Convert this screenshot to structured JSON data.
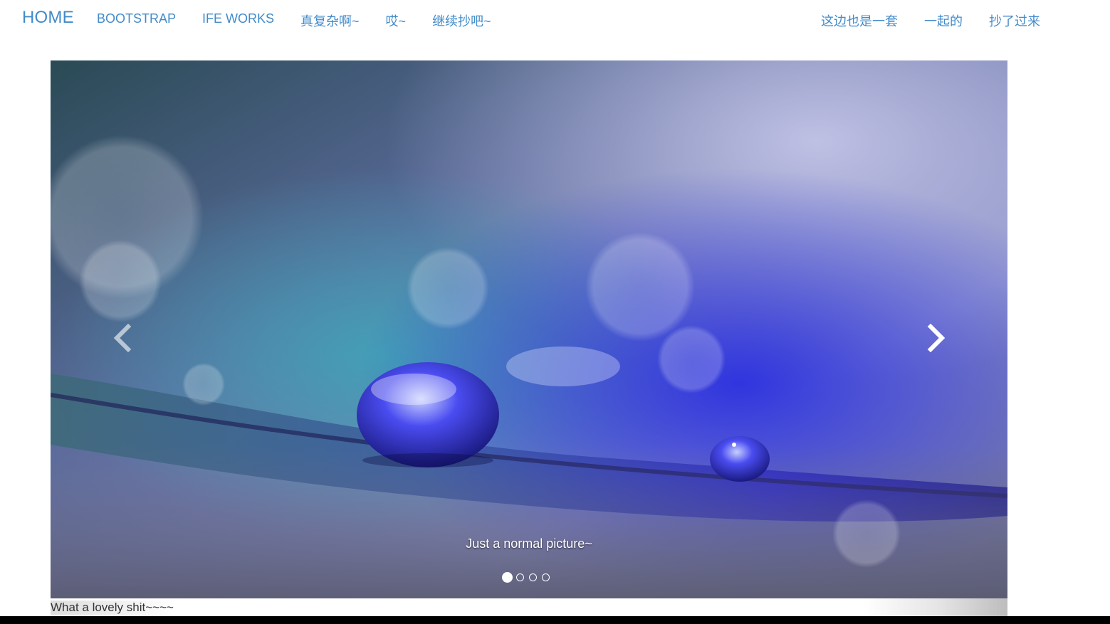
{
  "navbar": {
    "brand": "HOME",
    "left_links": [
      {
        "label": "BOOTSTRAP"
      },
      {
        "label": "IFE WORKS"
      },
      {
        "label": "真复杂啊~"
      },
      {
        "label": "哎~"
      },
      {
        "label": "继续抄吧~"
      }
    ],
    "right_links": [
      {
        "label": "这边也是一套"
      },
      {
        "label": "一起的"
      },
      {
        "label": "抄了过来"
      }
    ],
    "link_color": "#428bca"
  },
  "carousel": {
    "caption": "Just a normal picture~",
    "slide_count": 4,
    "active_index": 0,
    "prev_icon": "chevron-left-icon",
    "next_icon": "chevron-right-icon"
  },
  "footer": {
    "text": "What a lovely shit~~~~"
  }
}
